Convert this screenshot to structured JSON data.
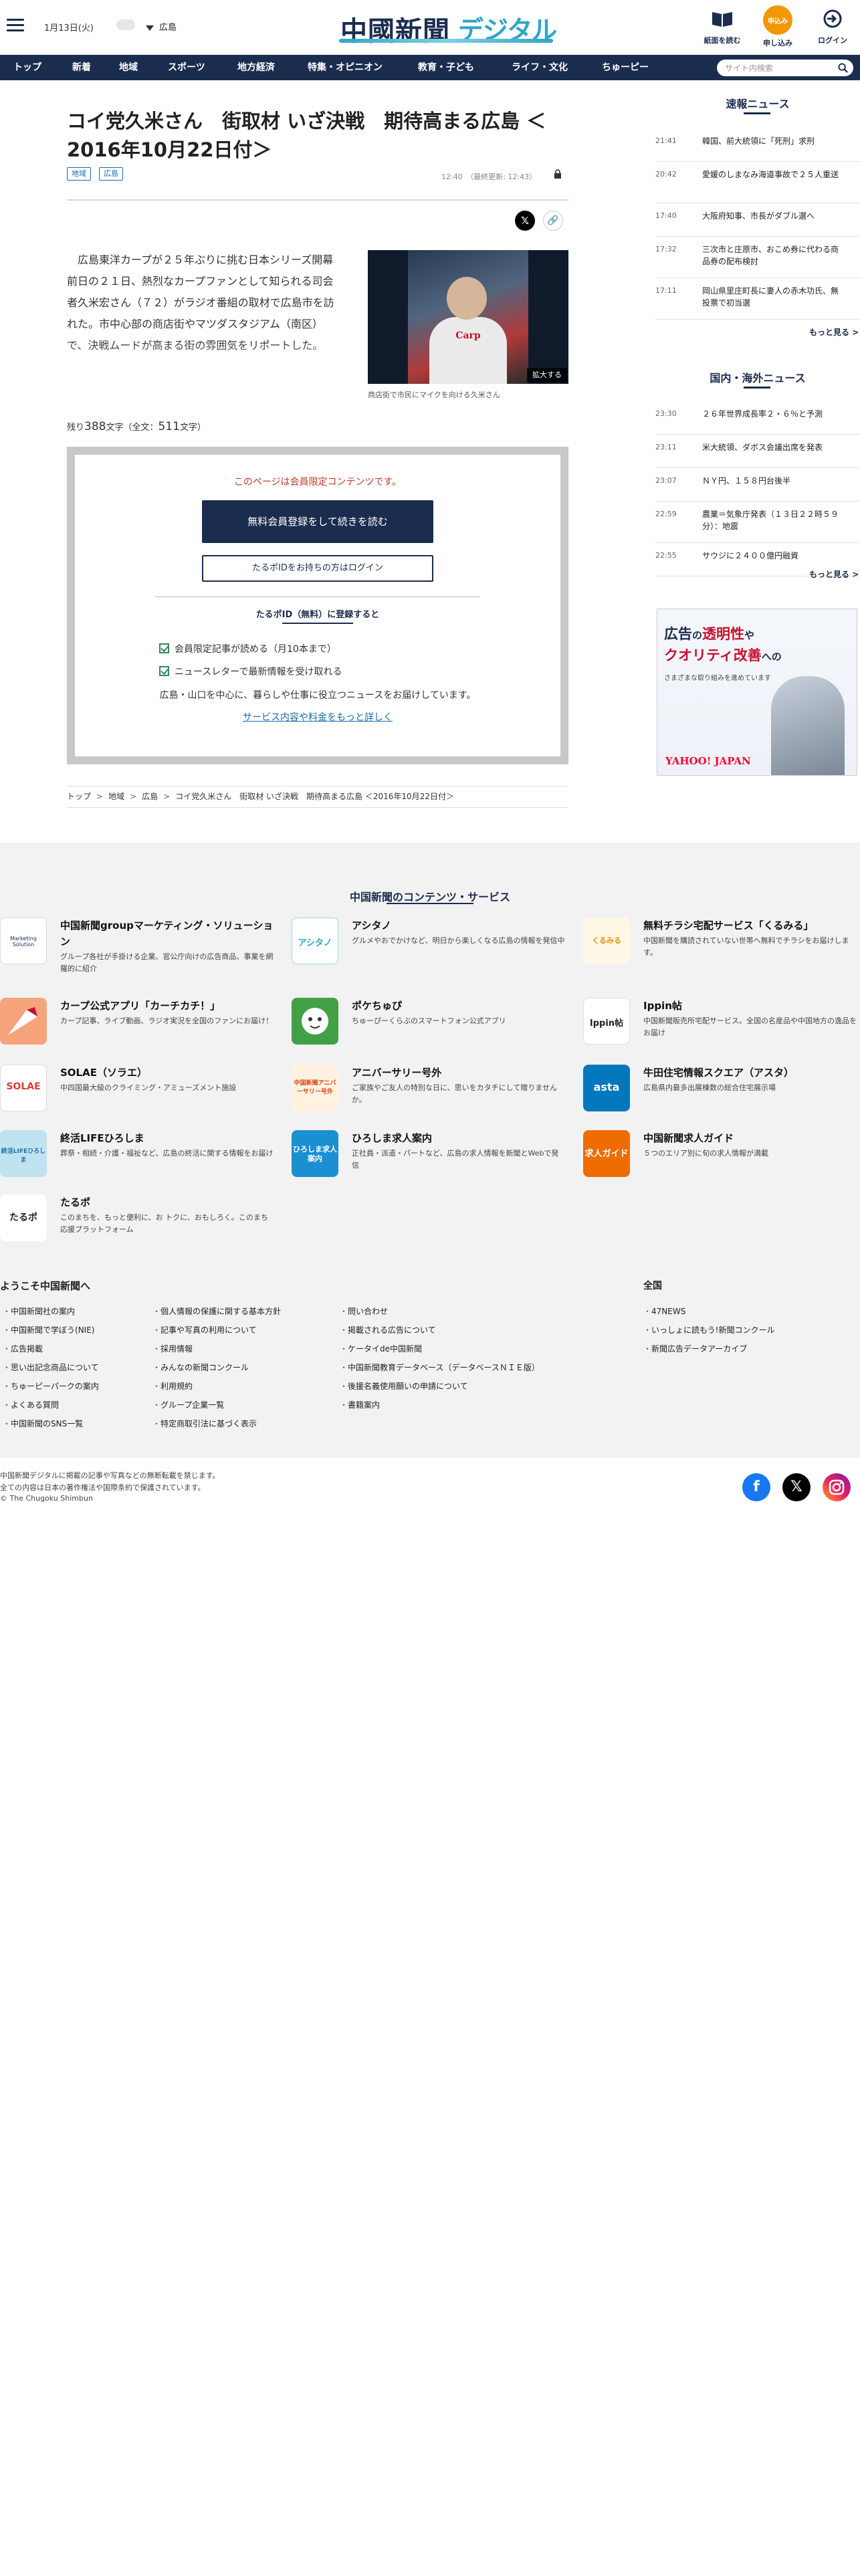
{
  "header": {
    "date": "1月13日(火)",
    "region": "広島",
    "logo_main": "中國新聞",
    "logo_sub": "デジタル",
    "icons": [
      {
        "name": "paper-icon",
        "label": "紙面を読む"
      },
      {
        "name": "subscribe-icon",
        "label": "申し込み",
        "badge": "申込み"
      },
      {
        "name": "login-icon",
        "label": "ログイン"
      }
    ]
  },
  "nav": {
    "items": [
      "トップ",
      "新着",
      "地域",
      "スポーツ",
      "地方経済",
      "特集・オピニオン",
      "教育・子ども",
      "ライフ・文化",
      "ちゅーピー"
    ],
    "search_placeholder": "サイト内検索"
  },
  "article": {
    "title": "コイ党久米さん　街取材 いざ決戦　期待高まる広島 ＜2016年10月22日付＞",
    "tags": [
      "地域",
      "広島"
    ],
    "timestamp": "12:40　（最終更新: 12:43）",
    "lead": "　広島東洋カープが２５年ぶりに挑む日本シリーズ開幕前日の２１日、熱烈なカープファンとして知られる司会者久米宏さん（７２）がラジオ番組の取材で広島市を訪れた。市中心部の商店街やマツダスタジアム（南区）で、決戦ムードが高まる街の雰囲気をリポートした。",
    "photo_caption": "商店街で市民にマイクを向ける久米さん",
    "photo_text": "Carp",
    "enlarge_label": "拡大する",
    "remaining_prefix": "残り",
    "remaining_chars": "388",
    "remaining_mid": "文字（全文：",
    "total_chars": "511",
    "remaining_suffix": "文字）"
  },
  "paywall": {
    "notice": "このページは会員限定コンテンツです。",
    "register_label": "無料会員登録をして続きを読む",
    "login_label": "たるポIDをお持ちの方はログイン",
    "heading": "たるポID（無料）に登録すると",
    "benefits": [
      "会員限定記事が読める（月10本まで）",
      "ニュースレターで最新情報を受け取れる"
    ],
    "description": "広島・山口を中心に、暮らしや仕事に役立つニュースをお届けしています。",
    "more_link": "サービス内容や料金をもっと詳しく"
  },
  "breadcrumb": [
    "トップ",
    "地域",
    "広島",
    "コイ党久米さん　街取材 いざ決戦　期待高まる広島 ＜2016年10月22日付＞"
  ],
  "sidebar": {
    "breaking_title": "速報ニュース",
    "breaking": [
      {
        "time": "21:41",
        "text": "韓国、前大統領に「死刑」求刑"
      },
      {
        "time": "20:42",
        "text": "愛媛のしまなみ海道事故で２５人重送"
      },
      {
        "time": "17:40",
        "text": "大阪府知事、市長がダブル選へ"
      },
      {
        "time": "17:32",
        "text": "三次市と庄原市、おこめ券に代わる商品券の配布検討"
      },
      {
        "time": "17:11",
        "text": "岡山県里庄町長に妻人の赤木功氏、無投票で初当選"
      }
    ],
    "more_label": "もっと見る",
    "world_title": "国内・海外ニュース",
    "world": [
      {
        "time": "23:30",
        "text": "２６年世界成長率２・６％と予測"
      },
      {
        "time": "23:11",
        "text": "米大統領、ダボス会議出席を発表"
      },
      {
        "time": "23:07",
        "text": "ＮＹ円、１５８円台後半"
      },
      {
        "time": "22:59",
        "text": "農業＝気象庁発表（１３日２２時５９分）：地震"
      },
      {
        "time": "22:55",
        "text": "サウジに２４００億円融資"
      }
    ],
    "ad": {
      "headline_1": "広告",
      "headline_2": "の",
      "headline_3": "透明性",
      "headline_4": "や",
      "headline_5": "クオリティ改善",
      "headline_6": "への",
      "sub": "さまざまな取り組みを進めています",
      "logo": "YAHOO! JAPAN"
    }
  },
  "services": {
    "title": "中国新聞のコンテンツ・サービス",
    "items": [
      {
        "name": "中国新聞groupマーケティング・ソリューション",
        "desc": "グループ各社が手掛ける企業、官公庁向けの広告商品、事業を網羅的に紹介",
        "thumb": "Marketing Solution"
      },
      {
        "name": "アシタノ",
        "desc": "グルメやおでかけなど、明日から楽しくなる広島の情報を発信中",
        "thumb": "アシタノ"
      },
      {
        "name": "無料チラシ宅配サービス「くるみる」",
        "desc": "中国新聞を購読されていない世帯へ無料でチラシをお届けします。",
        "thumb": "くるみる"
      },
      {
        "name": "カープ公式アプリ「カーチカチ！」",
        "desc": "カープ記事、ライブ動画、ラジオ実況を全国のファンにお届け！",
        "thumb": ""
      },
      {
        "name": "ポケちゅぴ",
        "desc": "ちゅーぴーくらぶのスマートフォン公式アプリ",
        "thumb": ""
      },
      {
        "name": "Ippin帖",
        "desc": "中国新聞販売所宅配サービス。全国の名産品や中国地方の逸品をお届け",
        "thumb": "Ippin帖"
      },
      {
        "name": "SOLAE（ソラエ）",
        "desc": "中四国最大級のクライミング・アミューズメント施設",
        "thumb": "SOLAE"
      },
      {
        "name": "アニバーサリー号外",
        "desc": "ご家族やご友人の特別な日に、思いをカタチにして贈りませんか。",
        "thumb": "中国新聞アニバーサリー号外"
      },
      {
        "name": "牛田住宅情報スクエア（アスタ）",
        "desc": "広島県内最多出展棟数の総合住宅展示場",
        "thumb": "asta"
      },
      {
        "name": "終活LIFEひろしま",
        "desc": "葬祭・相続・介護・福祉など、広島の終活に関する情報をお届け",
        "thumb": "終活LIFEひろしま"
      },
      {
        "name": "ひろしま求人案内",
        "desc": "正社員・派遣・パートなど、広島の求人情報を新聞とWebで発信",
        "thumb": "ひろしま求人案内"
      },
      {
        "name": "中国新聞求人ガイド",
        "desc": "５つのエリア別に旬の求人情報が満載",
        "thumb": "求人ガイド"
      },
      {
        "name": "たるポ",
        "desc": "このまちを、もっと便利に、お トクに、おもしろく。このまち応援プラットフォーム",
        "thumb": "たるポ"
      }
    ]
  },
  "footer_links": {
    "welcome_title": "ようこそ中国新聞へ",
    "col1": [
      "中国新聞社の案内",
      "中国新聞で学ぼう(NIE)",
      "広告掲載",
      "思い出記念商品について",
      "ちゅーピーパークの案内",
      "よくある質問",
      "中国新聞のSNS一覧"
    ],
    "col2": [
      "個人情報の保護に関する基本方針",
      "記事や写真の利用について",
      "採用情報",
      "みんなの新聞コンクール",
      "利用規約",
      "グループ企業一覧",
      "特定商取引法に基づく表示"
    ],
    "col3": [
      "問い合わせ",
      "掲載される広告について",
      "ケータイde中国新聞",
      "中国新聞教育データベース（データベースＮＩＥ版）",
      "後援名義使用願いの申請について",
      "書籍案内"
    ],
    "national_title": "全国",
    "national": [
      "47NEWS",
      "いっしょに読もう!新聞コンクール",
      "新聞広告データアーカイブ"
    ]
  },
  "footer": {
    "copy_1": "中国新聞デジタルに掲載の記事や写真などの無断転載を禁じます。",
    "copy_2": "全ての内容は日本の著作権法や国際条約で保護されています。",
    "copy_3": "© The Chugoku Shimbun"
  },
  "colors": {
    "navy": "#1b2d4f",
    "accent": "#2fa6c8",
    "orange": "#f39800",
    "link": "#1b6ca8"
  }
}
